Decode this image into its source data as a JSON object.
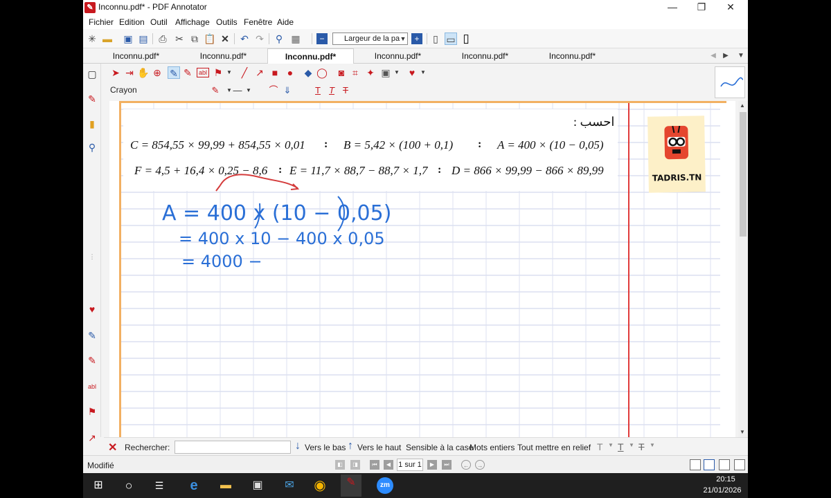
{
  "window": {
    "title": "Inconnu.pdf* - PDF Annotator",
    "minimize": "—",
    "restore": "❐",
    "close": "✕"
  },
  "menu": [
    "Fichier",
    "Edition",
    "Outil",
    "Affichage",
    "Outils",
    "Fenêtre",
    "Aide"
  ],
  "toolbar": {
    "zoom_select": "Largeur de la pa"
  },
  "tabs": [
    "Inconnu.pdf*",
    "Inconnu.pdf*",
    "Inconnu.pdf*",
    "Inconnu.pdf*",
    "Inconnu.pdf*",
    "Inconnu.pdf*"
  ],
  "active_tab_index": 2,
  "annotation_toolbar": {
    "tool_name": "Crayon",
    "text_tool": "abl"
  },
  "document": {
    "heading": "احسب :",
    "line1": {
      "c": "C = 854,55 × 99,99 + 854,55 × 0,01",
      "b": "B = 5,42 × (100 + 0,1)",
      "a": "A = 400 × (10 − 0,05)"
    },
    "line2": {
      "f": "F = 4,5 + 16,4 × 0,25 − 8,6",
      "e": "E = 11,7 × 88,7 − 88,7 × 1,7",
      "d": "D = 866 × 99,99 − 866 × 89,99"
    },
    "separator": ":",
    "handwriting": {
      "line1": "A = 400 x (10 − 0,05)",
      "line2": "= 400 x 10  −  400 x 0,05",
      "line3": "= 4000 −"
    },
    "logo_text": "TADRIS.TN"
  },
  "searchbar": {
    "label": "Rechercher:",
    "search_value": "",
    "down": "Vers le bas",
    "up": "Vers le haut",
    "match_case": "Sensible à la case",
    "whole_words": "Mots entiers",
    "highlight_all": "Tout mettre en relief"
  },
  "statusbar": {
    "status": "Modifié",
    "page": "1 sur 1"
  },
  "taskbar": {
    "time": "20:15",
    "date": "21/01/2026",
    "zoom_label": "zm"
  },
  "colors": {
    "accent": "#c8191f",
    "ink": "#2a6fd6",
    "grid_line": "#c9cfe8",
    "margin_line": "#e03a3a",
    "paper_border": "#f2b062"
  }
}
